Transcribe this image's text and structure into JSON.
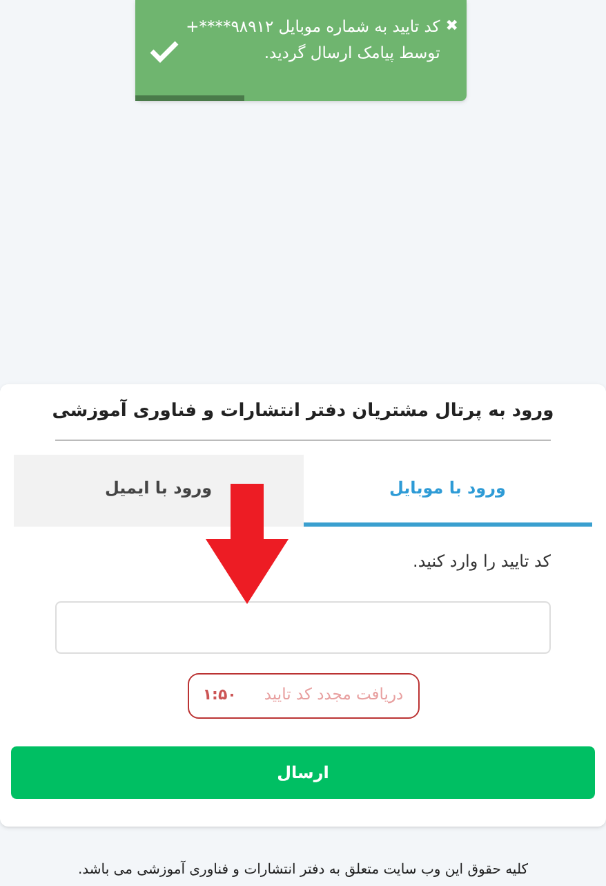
{
  "toast": {
    "close": "✖",
    "message": "کد تایید به شماره موبایل ۹۸۹۱۲****+ توسط پیامک ارسال گردید.",
    "level": 0.33
  },
  "card": {
    "title": "ورود به پرتال مشتریان دفتر انتشارات و فناوری آموزشی",
    "tabs": [
      {
        "label": "ورود با موبایل",
        "selected": true
      },
      {
        "label": "ورود با ایمیل",
        "selected": false
      }
    ],
    "field_label": "کد تایید را وارد کنید.",
    "resend": {
      "label": "دریافت مجدد کد تایید",
      "timer": "۱:۵۰",
      "disabled": true
    },
    "submit": "ارسال"
  },
  "footer": "کلیه حقوق این وب سایت متعلق به دفتر انتشارات و فناوری آموزشی می باشد."
}
